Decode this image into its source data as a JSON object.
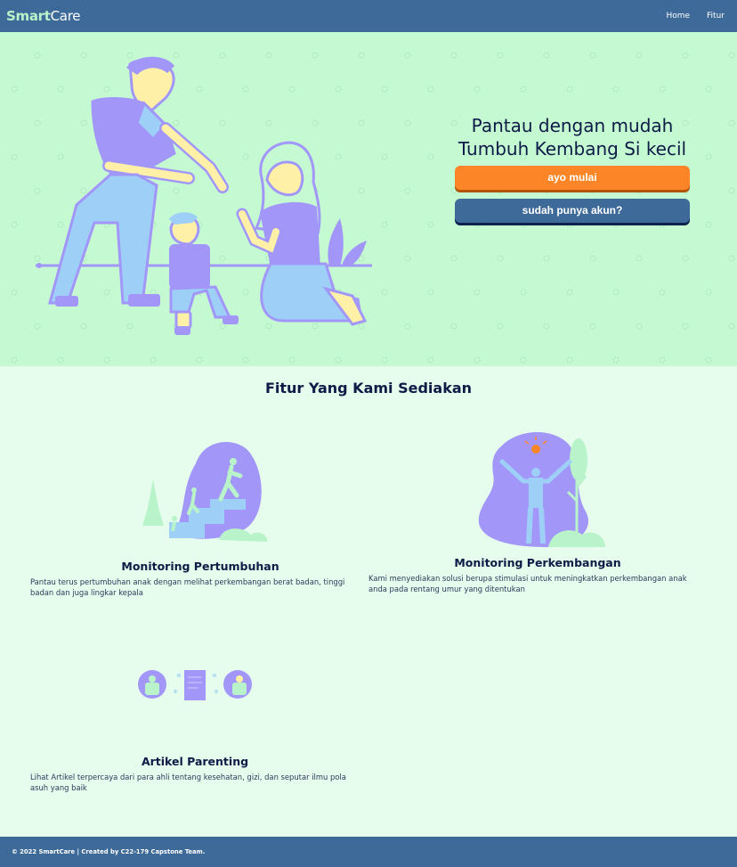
{
  "navbar": {
    "brand_part1": "Smart",
    "brand_part2": "Care",
    "links": [
      "Home",
      "Fitur"
    ]
  },
  "hero": {
    "title": "Pantau dengan mudah Tumbuh Kembang Si kecil",
    "start_button": "ayo mulai",
    "login_button": "sudah punya akun?"
  },
  "features": {
    "title": "Fitur Yang Kami Sediakan",
    "items": [
      {
        "name": "Monitoring Pertumbuhan",
        "desc": "Pantau terus pertumbuhan anak dengan melihat perkembangan berat badan, tinggi badan dan juga lingkar kepala"
      },
      {
        "name": "Monitoring Perkembangan",
        "desc": "Kami menyediakan solusi berupa stimulasi untuk meningkatkan perkembangan anak anda pada rentang umur yang ditentukan"
      },
      {
        "name": "Artikel Parenting",
        "desc": "Lihat Artikel terpercaya dari para ahli tentang kesehatan, gizi, dan seputar ilmu pola asuh yang baik"
      }
    ]
  },
  "footer": {
    "text": "© 2022 SmartCare | Created by C22-179 Capstone Team."
  },
  "colors": {
    "navbar": "#3d6a98",
    "hero_bg": "#c4f9d2",
    "page_bg": "#e6fcec",
    "accent_purple": "#a297f9",
    "accent_orange": "#fc8627",
    "navy": "#0e1b46"
  }
}
